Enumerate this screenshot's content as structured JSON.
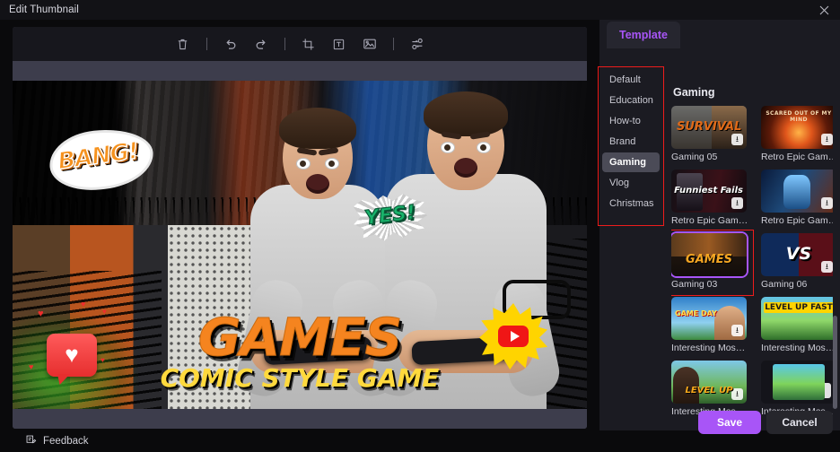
{
  "window": {
    "title": "Edit Thumbnail",
    "close_icon": "close-icon"
  },
  "toolbar": {
    "items": [
      {
        "name": "delete-tool",
        "icon": "trash-icon",
        "label": "Delete"
      },
      {
        "name": "separator-1",
        "icon": "divider",
        "label": ""
      },
      {
        "name": "undo-tool",
        "icon": "undo-icon",
        "label": "Undo"
      },
      {
        "name": "redo-tool",
        "icon": "redo-icon",
        "label": "Redo"
      },
      {
        "name": "separator-2",
        "icon": "divider",
        "label": ""
      },
      {
        "name": "crop-tool",
        "icon": "crop-icon",
        "label": "Crop"
      },
      {
        "name": "text-tool",
        "icon": "text-box-icon",
        "label": "Text"
      },
      {
        "name": "image-tool",
        "icon": "image-icon",
        "label": "Image"
      },
      {
        "name": "separator-3",
        "icon": "divider",
        "label": ""
      },
      {
        "name": "transform-tool",
        "icon": "replace-media-icon",
        "label": "Replace"
      }
    ]
  },
  "canvas": {
    "headline": "GAMES",
    "subline": "COMIC STYLE GAME",
    "sticker_bang": "BANG!",
    "sticker_yes": "YES!",
    "sticker_heart": "♥",
    "sticker_youtube": "youtube-play-icon"
  },
  "panel": {
    "tab": "Template",
    "categories": [
      {
        "label": "Default",
        "active": false
      },
      {
        "label": "Education",
        "active": false
      },
      {
        "label": "How-to",
        "active": false
      },
      {
        "label": "Brand",
        "active": false
      },
      {
        "label": "Gaming",
        "active": true
      },
      {
        "label": "Vlog",
        "active": false
      },
      {
        "label": "Christmas",
        "active": false
      }
    ],
    "section_title": "Gaming",
    "templates": [
      {
        "label": "Gaming 05",
        "selected": false,
        "download": true
      },
      {
        "label": "Retro Epic Games...",
        "selected": false,
        "download": true
      },
      {
        "label": "Retro Epic Games...",
        "selected": false,
        "download": true
      },
      {
        "label": "Retro Epic Games...",
        "selected": false,
        "download": true
      },
      {
        "label": "Gaming 03",
        "selected": true,
        "download": false
      },
      {
        "label": "Gaming 06",
        "selected": false,
        "download": true
      },
      {
        "label": "Interesting Mosai...",
        "selected": false,
        "download": true
      },
      {
        "label": "Interesting Mosai...",
        "selected": false,
        "download": false
      },
      {
        "label": "Interesting Mosai...",
        "selected": false,
        "download": true
      },
      {
        "label": "Interesting Mosai...",
        "selected": false,
        "download": true
      }
    ]
  },
  "footer": {
    "feedback": "Feedback",
    "feedback_icon": "feedback-icon",
    "save": "Save",
    "cancel": "Cancel"
  },
  "colors": {
    "accent": "#a855f7",
    "highlight_box": "#ee1c1c",
    "panel_bg": "#1b1b22",
    "app_bg": "#0a0a0c"
  }
}
